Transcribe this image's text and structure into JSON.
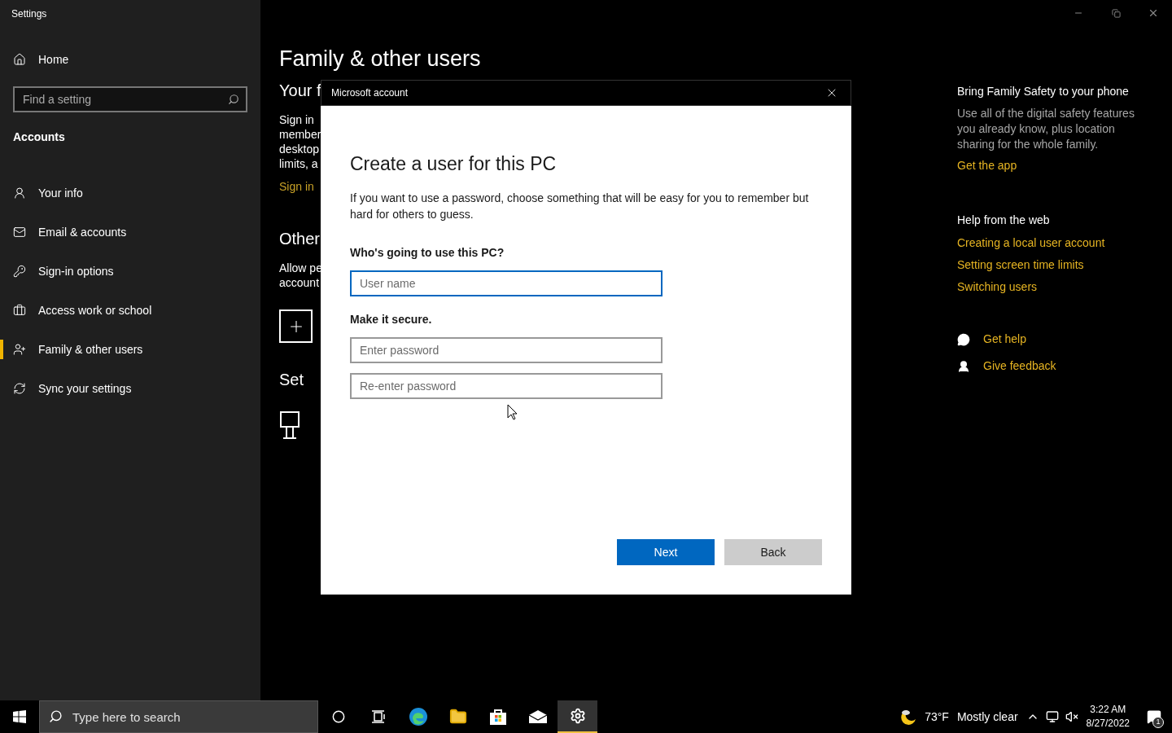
{
  "window": {
    "title": "Settings"
  },
  "sidebar": {
    "home": "Home",
    "search": {
      "placeholder": "Find a setting"
    },
    "section": "Accounts",
    "items": [
      {
        "label": "Your info",
        "selected": false
      },
      {
        "label": "Email & accounts",
        "selected": false
      },
      {
        "label": "Sign-in options",
        "selected": false
      },
      {
        "label": "Access work or school",
        "selected": false
      },
      {
        "label": "Family & other users",
        "selected": true
      },
      {
        "label": "Sync your settings",
        "selected": false
      }
    ]
  },
  "main": {
    "title": "Family & other users",
    "your_family": {
      "heading": "Your f",
      "lines": [
        "Sign in",
        "member",
        "desktop",
        "limits, a"
      ],
      "link": "Sign in"
    },
    "other_users": {
      "heading": "Other",
      "lines": [
        "Allow pe",
        "account"
      ]
    },
    "set_up": {
      "heading": "Set"
    }
  },
  "right_panel": {
    "promo": {
      "heading": "Bring Family Safety to your phone",
      "text": "Use all of the digital safety features you already know, plus location sharing for the whole family.",
      "link": "Get the app"
    },
    "help": {
      "heading": "Help from the web",
      "links": [
        "Creating a local user account",
        "Setting screen time limits",
        "Switching users"
      ]
    },
    "actions": [
      "Get help",
      "Give feedback"
    ]
  },
  "dialog": {
    "title": "Microsoft account",
    "heading": "Create a user for this PC",
    "intro": "If you want to use a password, choose something that will be easy for you to remember but hard for others to guess.",
    "who_label": "Who's going to use this PC?",
    "username": {
      "placeholder": "User name",
      "focused": true
    },
    "secure_label": "Make it secure.",
    "password": {
      "placeholder": "Enter password"
    },
    "password_again": {
      "placeholder": "Re-enter password"
    },
    "buttons": [
      {
        "label": "Next",
        "kind": "primary"
      },
      {
        "label": "Back",
        "kind": "secondary"
      }
    ]
  },
  "taskbar": {
    "search": {
      "placeholder": "Type here to search"
    },
    "apps": [
      {
        "selected": false
      },
      {
        "selected": false
      },
      {
        "selected": false
      },
      {
        "selected": false
      },
      {
        "selected": false
      },
      {
        "selected": false
      },
      {
        "selected": true
      }
    ],
    "weather": {
      "temperature": "73°F",
      "condition": "Mostly clear"
    },
    "time": "3:22 AM",
    "date": "8/27/2022",
    "notifications": "1"
  }
}
